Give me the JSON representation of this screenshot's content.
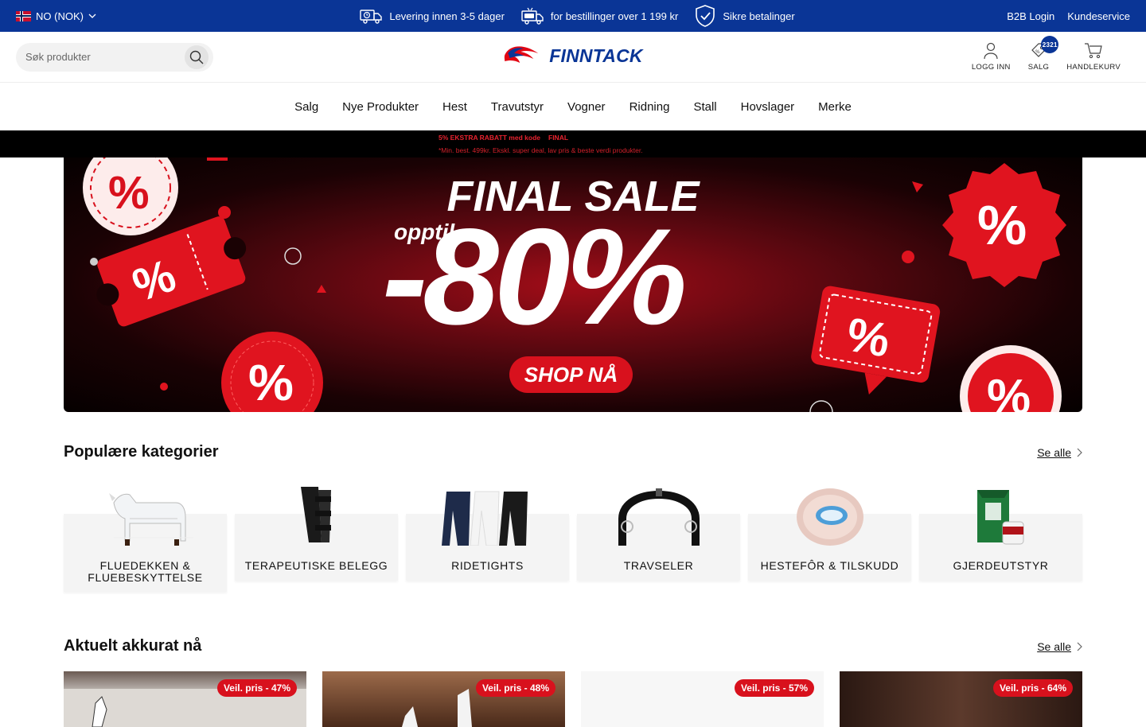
{
  "topbar": {
    "locale": "NO (NOK)",
    "usps": [
      "Levering innen 3-5 dager",
      "for bestillinger over 1 199 kr",
      "Sikre betalinger"
    ],
    "links": [
      "B2B Login",
      "Kundeservice"
    ]
  },
  "header": {
    "search_placeholder": "Søk produkter",
    "logo": "FINNTACK",
    "actions": {
      "login": "LOGG INN",
      "sale": "SALG",
      "sale_badge": "2321",
      "cart": "HANDLEKURV"
    }
  },
  "nav": [
    "Salg",
    "Nye Produkter",
    "Hest",
    "Travutstyr",
    "Vogner",
    "Ridning",
    "Stall",
    "Hovslager",
    "Merke"
  ],
  "promo": {
    "line1": "5% EKSTRA RABATT med kode",
    "code": "FINAL",
    "line2": "*Min. best. 499kr. Ekskl. super deal, lav pris & beste verdi produkter."
  },
  "hero": {
    "title": "FINAL SALE",
    "prefix": "opptil",
    "discount": "-80%",
    "cta": "SHOP NÅ"
  },
  "popular": {
    "title": "Populære kategorier",
    "see_all": "Se alle",
    "categories": [
      "FLUEDEKKEN & FLUEBESKYTTELSE",
      "TERAPEUTISKE BELEGG",
      "RIDETIGHTS",
      "TRAVSELER",
      "HESTEFÔR & TILSKUDD",
      "GJERDEUTSTYR"
    ]
  },
  "current": {
    "title": "Aktuelt akkurat nå",
    "see_all": "Se alle",
    "badges": [
      "Veil. pris - 47%",
      "Veil. pris - 48%",
      "Veil. pris - 57%",
      "Veil. pris - 64%"
    ]
  },
  "colors": {
    "brand_blue": "#0a3596",
    "sale_red": "#d8111d"
  }
}
